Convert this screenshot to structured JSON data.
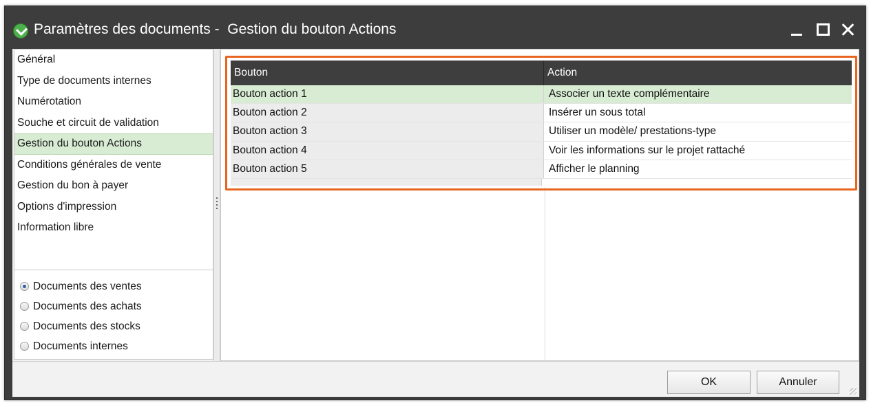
{
  "window": {
    "title": "Paramètres des documents -  Gestion du bouton Actions",
    "icon": "app-logo-icon",
    "controls": [
      "minimize-icon",
      "maximize-icon",
      "close-icon"
    ]
  },
  "sidebar": {
    "items": [
      {
        "label": "Général"
      },
      {
        "label": "Type de documents internes"
      },
      {
        "label": "Numérotation"
      },
      {
        "label": "Souche et circuit de validation"
      },
      {
        "label": "Gestion du bouton Actions",
        "selected": true
      },
      {
        "label": "Conditions générales de vente"
      },
      {
        "label": "Gestion du bon à payer"
      },
      {
        "label": "Options d'impression"
      },
      {
        "label": "Information libre"
      }
    ],
    "radios": [
      {
        "label": "Documents des ventes",
        "checked": true
      },
      {
        "label": "Documents des achats",
        "checked": false
      },
      {
        "label": "Documents des stocks",
        "checked": false
      },
      {
        "label": "Documents internes",
        "checked": false
      }
    ]
  },
  "grid": {
    "columns": [
      "Bouton",
      "Action"
    ],
    "rows": [
      {
        "bouton": "Bouton action 1",
        "action": "Associer un texte complémentaire",
        "selected": true
      },
      {
        "bouton": "Bouton action 2",
        "action": "Insérer un sous total"
      },
      {
        "bouton": "Bouton action 3",
        "action": "Utiliser un modèle/ prestations-type"
      },
      {
        "bouton": "Bouton action 4",
        "action": "Voir les informations sur le projet rattaché"
      },
      {
        "bouton": "Bouton action 5",
        "action": "Afficher le planning"
      }
    ]
  },
  "footer": {
    "ok_label": "OK",
    "cancel_label": "Annuler"
  },
  "colors": {
    "titlebar": "#3d3d3d",
    "selection": "#d8ecd4",
    "highlight_border": "#e8641f",
    "header": "#3e3e3e"
  }
}
